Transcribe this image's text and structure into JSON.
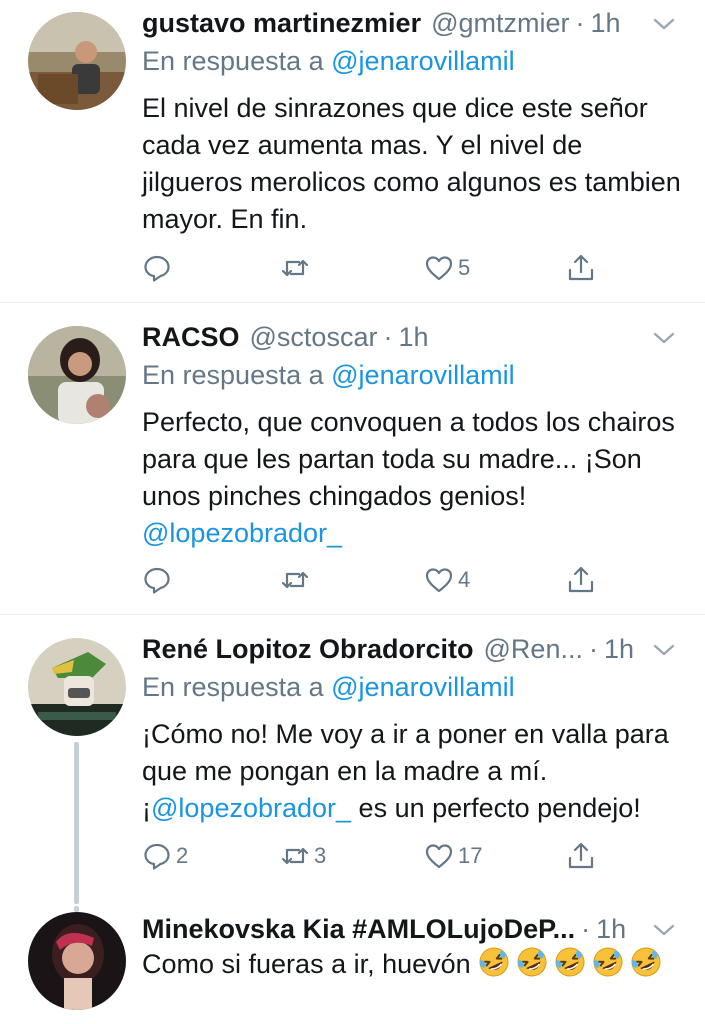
{
  "tweets": [
    {
      "name": "gustavo martinezmier",
      "handle": "@gmtzmier",
      "time": "1h",
      "reply_prefix": "En respuesta a",
      "reply_to": "@jenarovillamil",
      "text": "El nivel de sinrazones que dice este señor cada vez aumenta mas. Y el nivel de jilgueros merolicos como algunos es tambien mayor. En fin.",
      "replies": "",
      "retweets": "",
      "likes": "5"
    },
    {
      "name": "RACSO",
      "handle": "@sctoscar",
      "time": "1h",
      "reply_prefix": "En respuesta a",
      "reply_to": "@jenarovillamil",
      "text": "Perfecto, que convoquen a todos los chairos para que les partan toda su madre... ¡Son unos pinches chingados genios!",
      "text_mention": "@lopezobrador_",
      "replies": "",
      "retweets": "",
      "likes": "4"
    },
    {
      "name": "René Lopitoz Obradorcito",
      "handle": "@Ren...",
      "time": "1h",
      "reply_prefix": "En respuesta a",
      "reply_to": "@jenarovillamil",
      "text_line1": "¡Cómo no! Me voy a ir a poner en valla para que me pongan en la madre a mí.",
      "text_prefix": "¡",
      "text_mention": "@lopezobrador_",
      "text_suffix": " es un perfecto pendejo!",
      "replies": "2",
      "retweets": "3",
      "likes": "17"
    },
    {
      "name": "Minekovska Kia #AMLOLujoDeP...",
      "handle": "",
      "time": "1h",
      "text": "Como si fueras a ir, huevón",
      "emoji_count": 5
    }
  ],
  "separator": "·",
  "colors": {
    "text": "#14171a",
    "secondary": "#657786",
    "link": "#1b95e0",
    "divider": "#e6ecf0",
    "thread_line": "#c4cfd6"
  },
  "icons": [
    "reply-icon",
    "retweet-icon",
    "like-icon",
    "share-icon",
    "chevron-down-icon",
    "rofl-emoji"
  ]
}
